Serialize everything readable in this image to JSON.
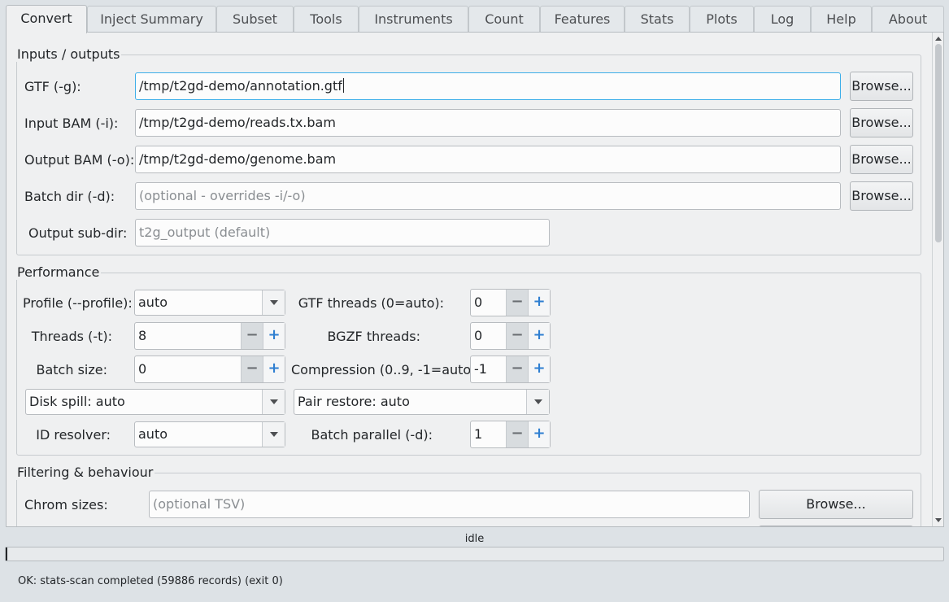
{
  "tabs": [
    {
      "label": "Convert",
      "active": true
    },
    {
      "label": "Inject Summary"
    },
    {
      "label": "Subset"
    },
    {
      "label": "Tools"
    },
    {
      "label": "Instruments"
    },
    {
      "label": "Count"
    },
    {
      "label": "Features"
    },
    {
      "label": "Stats"
    },
    {
      "label": "Plots"
    },
    {
      "label": "Log"
    },
    {
      "label": "Help"
    },
    {
      "label": "About"
    }
  ],
  "io": {
    "title": "Inputs / outputs",
    "gtf": {
      "label": "GTF (-g):",
      "value": "/tmp/t2gd-demo/annotation.gtf"
    },
    "input_bam": {
      "label": "Input BAM (-i):",
      "value": "/tmp/t2gd-demo/reads.tx.bam"
    },
    "output_bam": {
      "label": "Output BAM (-o):",
      "value": "/tmp/t2gd-demo/genome.bam"
    },
    "batch_dir": {
      "label": "Batch dir (-d):",
      "placeholder": "(optional - overrides -i/-o)"
    },
    "output_subdir": {
      "label": "Output sub-dir:",
      "placeholder": "t2g_output  (default)"
    },
    "browse_label": "Browse..."
  },
  "performance": {
    "title": "Performance",
    "profile": {
      "label": "Profile (--profile):",
      "value": "auto"
    },
    "threads": {
      "label": "Threads (-t):",
      "value": "8"
    },
    "batch_size": {
      "label": "Batch size:",
      "value": "0"
    },
    "disk_spill": {
      "value": "Disk spill: auto"
    },
    "id_resolver": {
      "label": "ID resolver:",
      "value": "auto"
    },
    "gtf_threads": {
      "label": "GTF threads (0=auto):",
      "value": "0"
    },
    "bgzf_threads": {
      "label": "BGZF threads:",
      "value": "0"
    },
    "compression": {
      "label": "Compression (0..9, -1=auto):",
      "value": "-1"
    },
    "pair_restore": {
      "value": "Pair restore: auto"
    },
    "batch_parallel": {
      "label": "Batch parallel (-d):",
      "value": "1"
    }
  },
  "filtering": {
    "title": "Filtering & behaviour",
    "chrom_sizes": {
      "label": "Chrom sizes:",
      "placeholder": "(optional TSV)"
    },
    "browse_label": "Browse..."
  },
  "spin_icons": {
    "minus": "minus-icon",
    "plus": "plus-icon"
  },
  "status": {
    "state": "idle",
    "progress": 0,
    "message": "OK: stats-scan completed (59886 records)  (exit 0)"
  },
  "colors": {
    "accent": "#3daee9",
    "spin_plus": "#2f7fd1",
    "background": "#eff0f1"
  }
}
